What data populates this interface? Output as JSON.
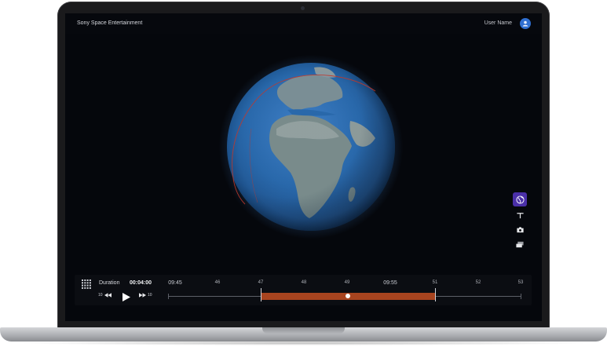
{
  "app": {
    "title": "Sony Space Entertainment"
  },
  "header": {
    "user_name": "User Name"
  },
  "tools": [
    {
      "name": "globe-view",
      "icon": "globe-icon",
      "active": true
    },
    {
      "name": "text-tool",
      "icon": "text-t-icon",
      "active": false
    },
    {
      "name": "camera-tool",
      "icon": "camera-icon",
      "active": false
    },
    {
      "name": "layers-tool",
      "icon": "layers-icon",
      "active": false
    }
  ],
  "timeline": {
    "duration_label": "Duration",
    "duration_value": "00:04:00",
    "rewind_label": "10",
    "forward_label": "10",
    "ticks": [
      "09:45",
      "46",
      "47",
      "48",
      "49",
      "09:55",
      "51",
      "52",
      "53"
    ],
    "playhead_fraction": 0.5
  },
  "colors": {
    "accent": "#4a2fa8",
    "range": "#a8441f",
    "avatar": "#2f6fd1",
    "orbit": "#c0392b"
  }
}
